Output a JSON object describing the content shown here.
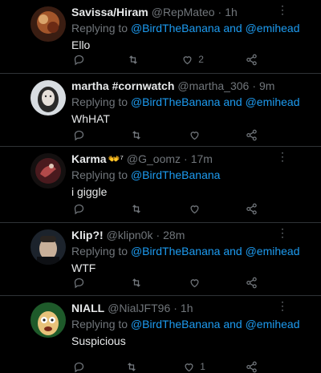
{
  "tweets": [
    {
      "name": "Savissa/Hiram",
      "handle": "@RepMateo",
      "time": "1h",
      "reply_prefix": "Replying to ",
      "reply_link": "@BirdTheBanana and @emihead",
      "text": "Ello",
      "like_count": "2",
      "avatar_color": "#8a4a2a"
    },
    {
      "name": "martha #cornwatch",
      "handle": "@martha_306",
      "time": "9m",
      "reply_prefix": "Replying to ",
      "reply_link": "@BirdTheBanana and @emihead",
      "text": "WhHAT",
      "avatar_color": "#cfd6dc"
    },
    {
      "name": "Karma",
      "badge": "👐⁷",
      "handle": "@G_oomz",
      "time": "17m",
      "reply_prefix": "Replying to ",
      "reply_link": "@BirdTheBanana",
      "text": "i giggle",
      "avatar_color": "#5a1e22"
    },
    {
      "name": "Klip?!",
      "handle": "@klipn0k",
      "time": "28m",
      "reply_prefix": "Replying to ",
      "reply_link": "@BirdTheBanana and @emihead",
      "text": "WTF",
      "avatar_color": "#2b3440"
    },
    {
      "name": "NIALL",
      "handle": "@NialJFT96",
      "time": "1h",
      "reply_prefix": "Replying to ",
      "reply_link": "@BirdTheBanana and @emihead",
      "text": "Suspicious",
      "like_count": "1",
      "avatar_color": "#2a7a3a"
    }
  ],
  "colors": {
    "background": "#000000",
    "link": "#1d9bf0",
    "muted": "#71767b",
    "text": "#e7e9ea"
  },
  "icons": [
    "reply-icon",
    "retweet-icon",
    "like-icon",
    "share-icon",
    "more-icon"
  ]
}
